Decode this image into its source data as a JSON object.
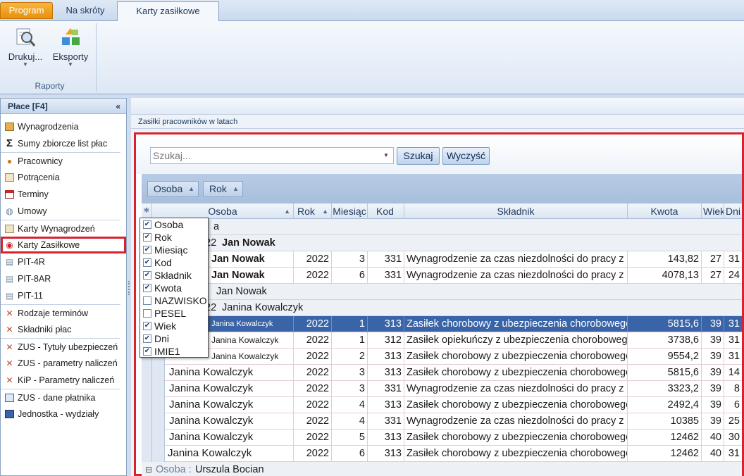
{
  "tabs": {
    "program": "Program",
    "skroty": "Na skróty",
    "karty": "Karty zasiłkowe"
  },
  "ribbon": {
    "drukuj": "Drukuj...",
    "eksporty": "Eksporty",
    "group": "Raporty"
  },
  "leftpanel": {
    "title": "Płace [F4]",
    "collapse": "«",
    "items": [
      {
        "label": "Wynagrodzenia",
        "icon": "payroll-icon"
      },
      {
        "label": "Sumy zbiorcze list płac",
        "icon": "sigma-icon"
      },
      {
        "label": "Pracownicy",
        "icon": "people-icon"
      },
      {
        "label": "Potrącenia",
        "icon": "deduction-icon"
      },
      {
        "label": "Terminy",
        "icon": "calendar-icon"
      },
      {
        "label": "Umowy",
        "icon": "contract-icon"
      },
      {
        "label": "Karty Wynagrodzeń",
        "icon": "card-icon"
      },
      {
        "label": "Karty Zasiłkowe",
        "icon": "benefit-card-icon"
      },
      {
        "label": "PIT-4R",
        "icon": "document-icon"
      },
      {
        "label": "PIT-8AR",
        "icon": "document-icon"
      },
      {
        "label": "PIT-11",
        "icon": "document-icon"
      },
      {
        "label": "Rodzaje terminów",
        "icon": "tools-icon"
      },
      {
        "label": "Składniki płac",
        "icon": "tools-icon"
      },
      {
        "label": "ZUS - Tytuły ubezpieczeń",
        "icon": "tools-icon"
      },
      {
        "label": "ZUS - parametry naliczeń",
        "icon": "tools-icon"
      },
      {
        "label": "KiP - Parametry naliczeń",
        "icon": "tools-icon"
      },
      {
        "label": "ZUS - dane płatnika",
        "icon": "zus-icon"
      },
      {
        "label": "Jednostka - wydziały",
        "icon": "unit-icon"
      }
    ]
  },
  "main": {
    "title": "Zasiłki pracowników w latach",
    "search_placeholder": "Szukaj...",
    "btn_szukaj": "Szukaj",
    "btn_wyczysc": "Wyczyść",
    "group_chips": [
      "Osoba",
      "Rok"
    ],
    "columns": [
      "Osoba",
      "Rok",
      "Miesiąc",
      "Kod",
      "Składnik",
      "Kwota",
      "Wiek",
      "Dni"
    ]
  },
  "grid": {
    "g1_suffix": "a",
    "g1a": {
      "prefix": "22",
      "name": "Jan Nowak"
    },
    "r1": {
      "osoba": "Jan Nowak",
      "rok": "2022",
      "mies": "3",
      "kod": "331",
      "skl": "Wynagrodzenie za czas niezdolności do pracy z",
      "kwota": "143,82",
      "wiek": "27",
      "dni": "31"
    },
    "r2": {
      "osoba": "Jan Nowak",
      "rok": "2022",
      "mies": "6",
      "kod": "331",
      "skl": "Wynagrodzenie za czas niezdolności do pracy z",
      "kwota": "4078,13",
      "wiek": "27",
      "dni": "24"
    },
    "g2": {
      "name": "Jan Nowak"
    },
    "g3": {
      "prefix": "22",
      "name": "Janina Kowalczyk"
    },
    "r3": {
      "osoba": "Janina Kowalczyk",
      "rok": "2022",
      "mies": "1",
      "kod": "313",
      "skl": "Zasiłek chorobowy z ubezpieczenia chorobowego",
      "kwota": "5815,6",
      "wiek": "39",
      "dni": "31"
    },
    "r4": {
      "osoba": "Janina Kowalczyk",
      "rok": "2022",
      "mies": "1",
      "kod": "312",
      "skl": "Zasiłek opiekuńczy z ubezpieczenia chorobowego",
      "kwota": "3738,6",
      "wiek": "39",
      "dni": "31"
    },
    "r5": {
      "osoba": "Janina Kowalczyk",
      "rok": "2022",
      "mies": "2",
      "kod": "313",
      "skl": "Zasiłek chorobowy z ubezpieczenia chorobowego",
      "kwota": "9554,2",
      "wiek": "39",
      "dni": "31"
    },
    "r6": {
      "osoba": "Janina Kowalczyk",
      "rok": "2022",
      "mies": "3",
      "kod": "313",
      "skl": "Zasiłek chorobowy z ubezpieczenia chorobowego",
      "kwota": "5815,6",
      "wiek": "39",
      "dni": "14"
    },
    "r7": {
      "osoba": "Janina Kowalczyk",
      "rok": "2022",
      "mies": "3",
      "kod": "331",
      "skl": "Wynagrodzenie za czas niezdolności do pracy z",
      "kwota": "3323,2",
      "wiek": "39",
      "dni": "8"
    },
    "r8": {
      "osoba": "Janina Kowalczyk",
      "rok": "2022",
      "mies": "4",
      "kod": "313",
      "skl": "Zasiłek chorobowy z ubezpieczenia chorobowego",
      "kwota": "2492,4",
      "wiek": "39",
      "dni": "6"
    },
    "r9": {
      "osoba": "Janina Kowalczyk",
      "rok": "2022",
      "mies": "4",
      "kod": "331",
      "skl": "Wynagrodzenie za czas niezdolności do pracy z",
      "kwota": "10385",
      "wiek": "39",
      "dni": "25"
    },
    "r10": {
      "osoba": "Janina Kowalczyk",
      "rok": "2022",
      "mies": "5",
      "kod": "313",
      "skl": "Zasiłek chorobowy z ubezpieczenia chorobowego",
      "kwota": "12462",
      "wiek": "40",
      "dni": "30"
    },
    "r11": {
      "osoba": "Janina Kowalczyk",
      "rok": "2022",
      "mies": "6",
      "kod": "313",
      "skl": "Zasiłek chorobowy z ubezpieczenia chorobowego",
      "kwota": "12462",
      "wiek": "40",
      "dni": "31"
    },
    "g4": {
      "label": "Osoba :",
      "name": "Urszula Bocian"
    }
  },
  "chooser": [
    {
      "label": "Osoba",
      "checked": true
    },
    {
      "label": "Rok",
      "checked": true
    },
    {
      "label": "Miesiąc",
      "checked": true
    },
    {
      "label": "Kod",
      "checked": true
    },
    {
      "label": "Składnik",
      "checked": true
    },
    {
      "label": "Kwota",
      "checked": true
    },
    {
      "label": "NAZWISKO",
      "checked": false
    },
    {
      "label": "PESEL",
      "checked": false
    },
    {
      "label": "Wiek",
      "checked": true
    },
    {
      "label": "Dni",
      "checked": true
    },
    {
      "label": "IMIE1",
      "checked": true
    }
  ],
  "colors": {
    "selection": "#3a64a8",
    "highlight_frame": "#d8232f",
    "program_tab": "#f0a020"
  }
}
